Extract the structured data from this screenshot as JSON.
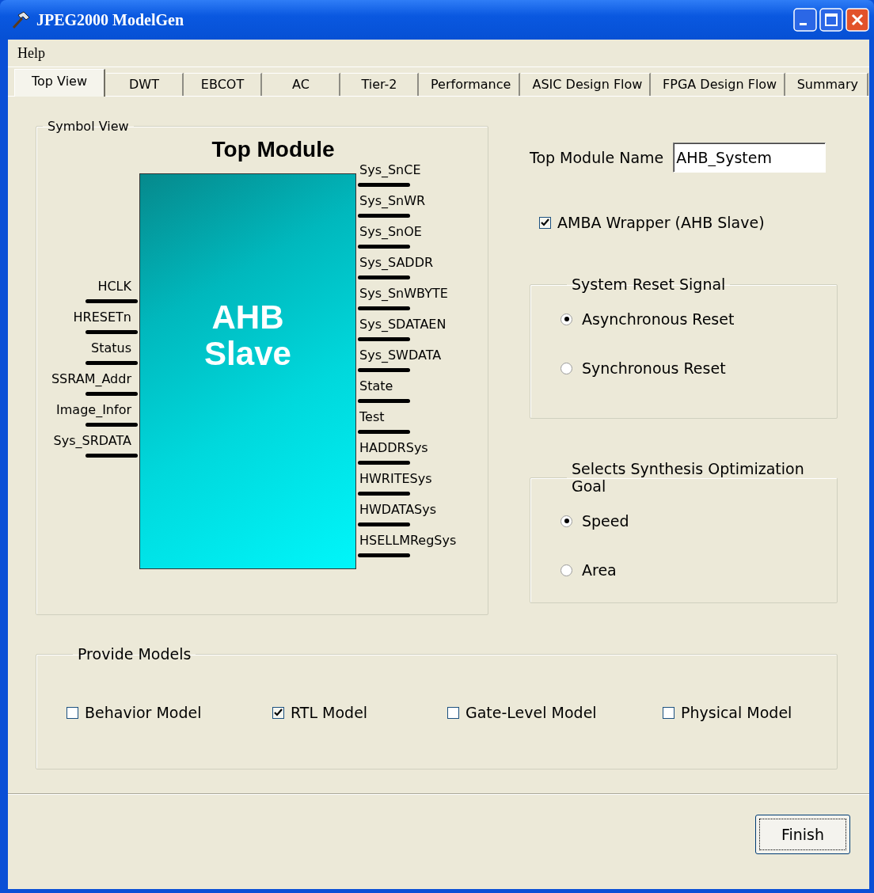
{
  "window": {
    "title": "JPEG2000 ModelGen"
  },
  "menu": [
    {
      "label": "Help"
    }
  ],
  "tabs": [
    {
      "label": "Top View",
      "selected": true
    },
    {
      "label": "DWT",
      "selected": false
    },
    {
      "label": "EBCOT",
      "selected": false
    },
    {
      "label": "AC",
      "selected": false
    },
    {
      "label": "Tier-2",
      "selected": false
    },
    {
      "label": "Performance",
      "selected": false
    },
    {
      "label": "ASIC Design Flow",
      "selected": false
    },
    {
      "label": "FPGA Design Flow",
      "selected": false
    },
    {
      "label": "Summary",
      "selected": false
    }
  ],
  "symbol_view": {
    "title": "Symbol View",
    "heading": "Top Module",
    "block_label": "AHB Slave",
    "inputs": [
      "HCLK",
      "HRESETn",
      "Status",
      "SSRAM_Addr",
      "Image_Infor",
      "Sys_SRDATA"
    ],
    "outputs": [
      "Sys_SnCE",
      "Sys_SnWR",
      "Sys_SnOE",
      "Sys_SADDR",
      "Sys_SnWBYTE",
      "Sys_SDATAEN",
      "Sys_SWDATA",
      "State",
      "Test",
      "HADDRSys",
      "HWRITESys",
      "HWDATASys",
      "HSELLMRegSys"
    ]
  },
  "top_module_name": {
    "label": "Top Module Name",
    "value": "AHB_System"
  },
  "amba_wrapper": {
    "label": "AMBA Wrapper (AHB Slave)",
    "checked": true
  },
  "reset_group": {
    "title": "System Reset Signal",
    "options": [
      {
        "label": "Asynchronous Reset",
        "selected": true
      },
      {
        "label": "Synchronous Reset",
        "selected": false
      }
    ]
  },
  "optimization_group": {
    "title": "Selects Synthesis Optimization Goal",
    "options": [
      {
        "label": "Speed",
        "selected": true
      },
      {
        "label": "Area",
        "selected": false
      }
    ]
  },
  "models": {
    "title": "Provide Models",
    "options": [
      {
        "label": "Behavior Model",
        "checked": false
      },
      {
        "label": "RTL Model",
        "checked": true
      },
      {
        "label": "Gate-Level Model",
        "checked": false
      },
      {
        "label": "Physical Model",
        "checked": false
      }
    ]
  },
  "finish_button": "Finish"
}
